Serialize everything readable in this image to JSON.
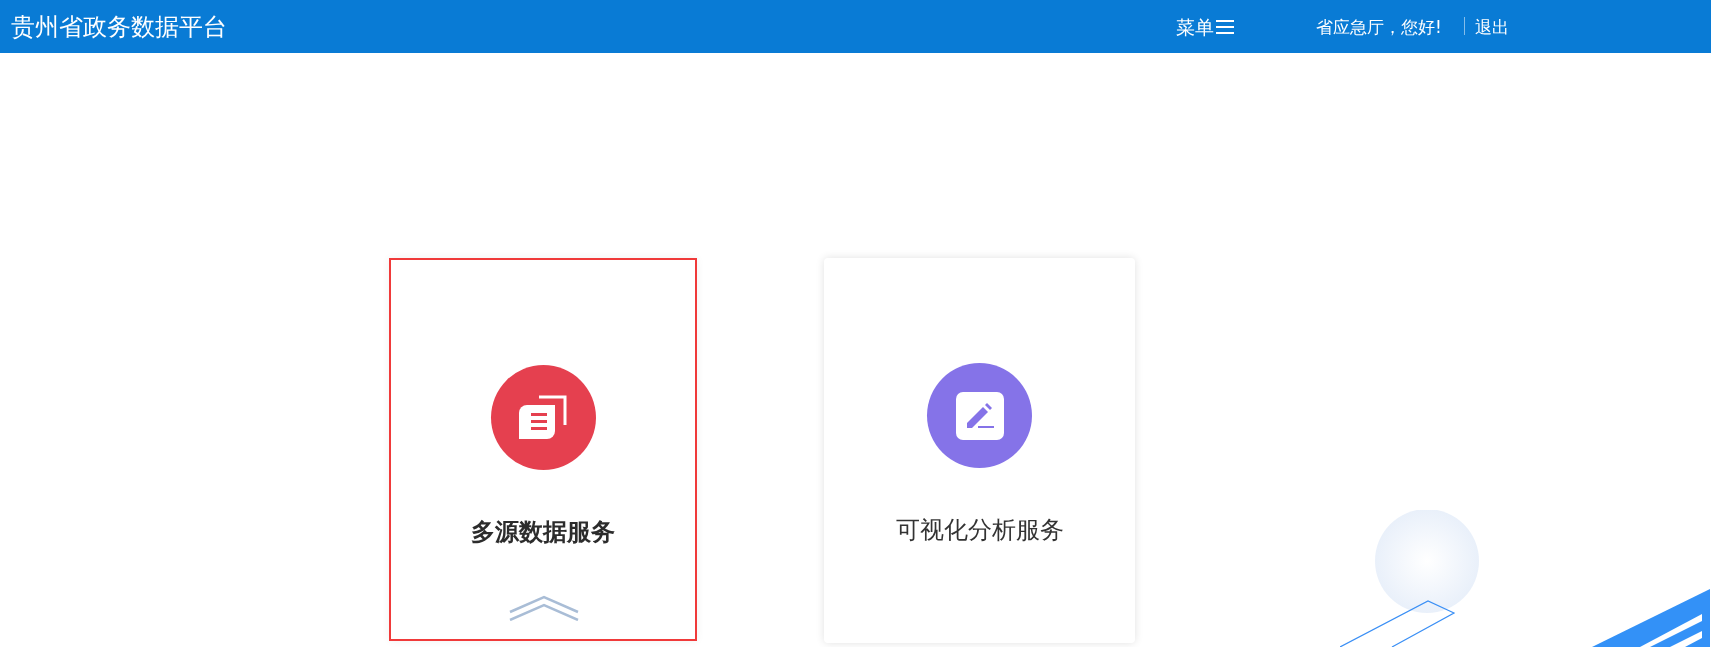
{
  "header": {
    "title": "贵州省政务数据平台",
    "menu_label": "菜单",
    "greeting": "省应急厅，您好!",
    "logout": "退出"
  },
  "cards": [
    {
      "title": "多源数据服务",
      "kind": "documents",
      "color": "#e5404f",
      "selected": true
    },
    {
      "title": "可视化分析服务",
      "kind": "edit",
      "color": "#8573e8",
      "selected": false
    }
  ]
}
